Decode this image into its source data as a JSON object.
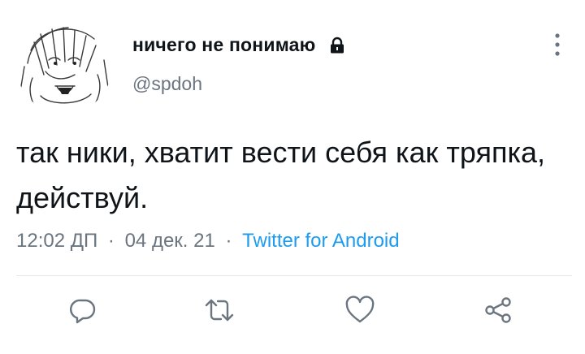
{
  "tweet": {
    "display_name": "ничего не понимаю",
    "handle": "@spdoh",
    "text": "так ники, хватит вести себя как тряпка, действуй.",
    "time": "12:02 ДП",
    "date": "04 дек. 21",
    "separator": "·",
    "source": "Twitter for Android"
  },
  "icons": {
    "lock": "lock-icon",
    "more": "more-vertical-icon",
    "reply": "reply-icon",
    "retweet": "retweet-icon",
    "like": "heart-icon",
    "share": "share-icon"
  },
  "colors": {
    "text_primary": "#0f1419",
    "text_secondary": "#6b7580",
    "link": "#1d9bf0",
    "divider": "#e6e9eb"
  }
}
